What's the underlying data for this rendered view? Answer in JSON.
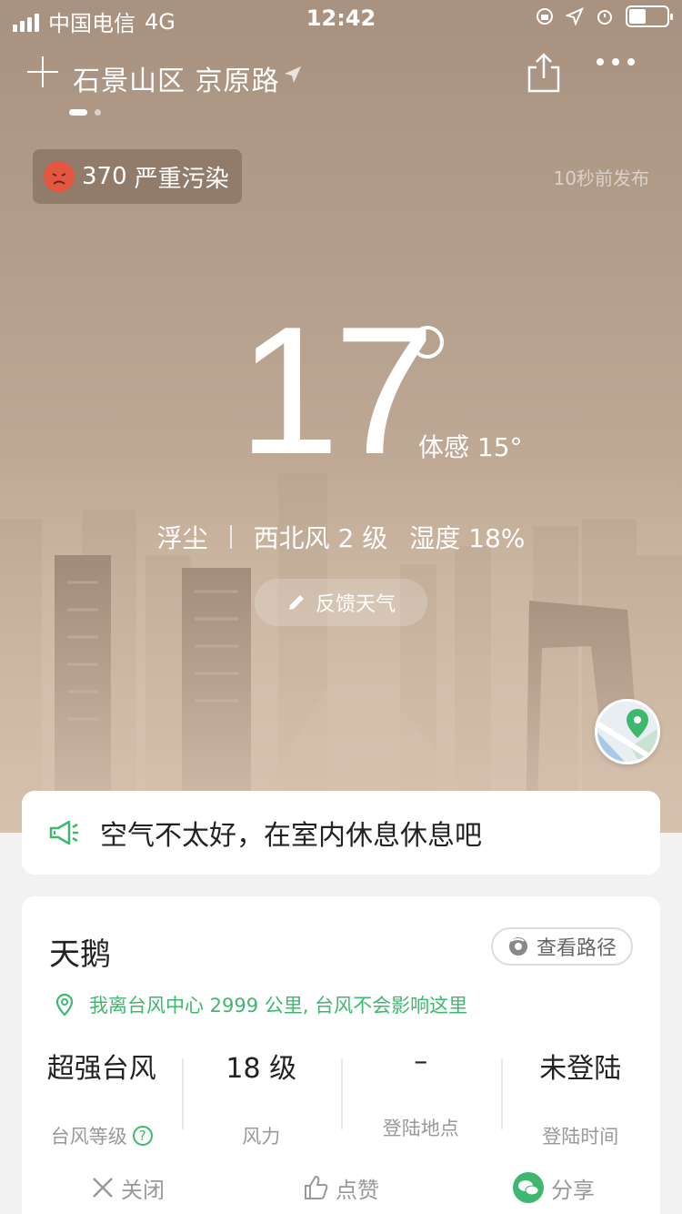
{
  "status_bar": {
    "carrier": "中国电信",
    "network": "4G",
    "time": "12:42",
    "battery_level": 0.45
  },
  "header": {
    "location": "石景山区 京原路",
    "icons": [
      "plus-icon",
      "location-arrow-icon",
      "share-icon",
      "more-icon"
    ]
  },
  "pager": {
    "current": 1,
    "total": 2
  },
  "air_quality": {
    "aqi": "370",
    "level": "严重污染",
    "face_color": "#e4573e"
  },
  "published": "10秒前发布",
  "weather": {
    "temperature": "17",
    "feels_like": "体感 15°",
    "condition": "浮尘",
    "wind": "西北风 2 级",
    "humidity": "湿度 18%"
  },
  "feedback_label": "反馈天气",
  "tip": {
    "text": "空气不太好，在室内休息休息吧",
    "icon": "megaphone-icon"
  },
  "typhoon": {
    "name": "天鹅",
    "route_label": "查看路径",
    "distance_text": "我离台风中心 2999 公里, 台风不会影响这里",
    "stats": [
      {
        "value": "超强台风",
        "label": "台风等级"
      },
      {
        "value": "18 级",
        "label": "风力"
      },
      {
        "value": "–",
        "label": "登陆地点"
      },
      {
        "value": "未登陆",
        "label": "登陆时间"
      }
    ],
    "actions": {
      "close": "关闭",
      "like": "点赞",
      "share": "分享"
    }
  },
  "colors": {
    "accent_green": "#3db86e",
    "sky_top": "#a9917f",
    "sky_bottom": "#d6c2ae"
  }
}
